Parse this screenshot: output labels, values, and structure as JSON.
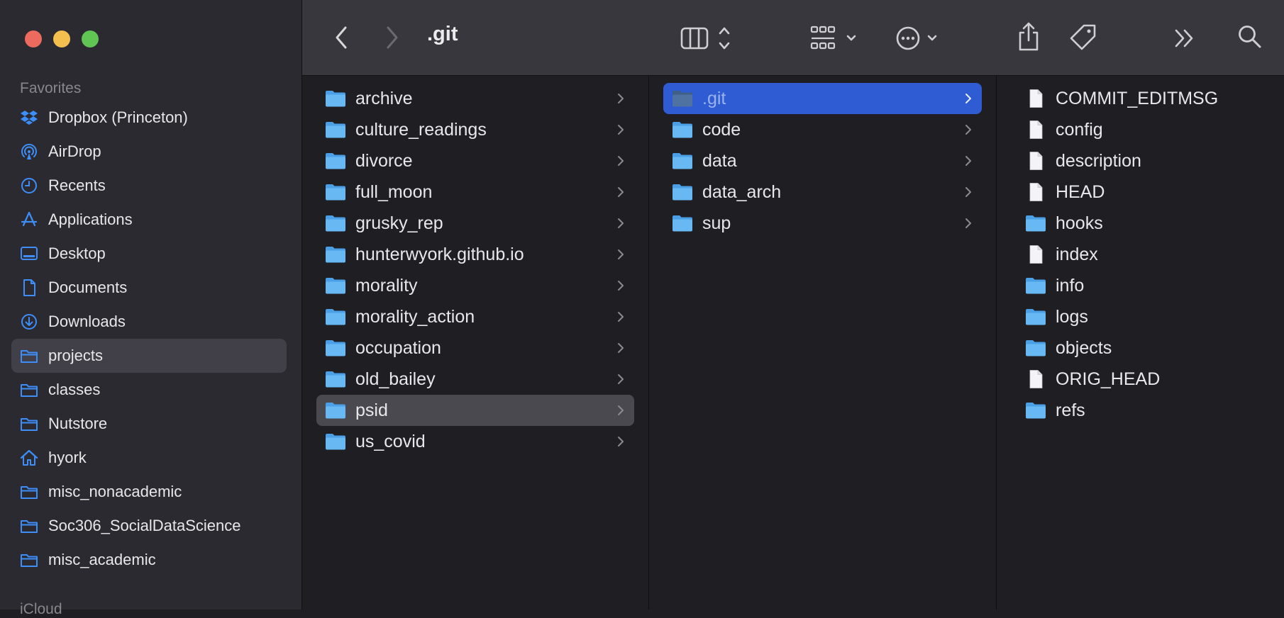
{
  "window": {
    "title": ".git"
  },
  "sidebar": {
    "section_title": "Favorites",
    "items": [
      {
        "label": "Dropbox (Princeton)",
        "icon": "dropbox-icon"
      },
      {
        "label": "AirDrop",
        "icon": "airdrop-icon"
      },
      {
        "label": "Recents",
        "icon": "clock-icon"
      },
      {
        "label": "Applications",
        "icon": "applications-icon"
      },
      {
        "label": "Desktop",
        "icon": "desktop-icon"
      },
      {
        "label": "Documents",
        "icon": "document-icon"
      },
      {
        "label": "Downloads",
        "icon": "download-icon"
      },
      {
        "label": "projects",
        "icon": "folder-icon",
        "selected": true
      },
      {
        "label": "classes",
        "icon": "folder-icon"
      },
      {
        "label": "Nutstore",
        "icon": "folder-icon"
      },
      {
        "label": "hyork",
        "icon": "home-icon"
      },
      {
        "label": "misc_nonacademic",
        "icon": "folder-icon"
      },
      {
        "label": "Soc306_SocialDataScience",
        "icon": "folder-icon"
      },
      {
        "label": "misc_academic",
        "icon": "folder-icon"
      }
    ],
    "next_section_partial": "iCloud"
  },
  "toolbar": {
    "back": "chevron-left-icon",
    "forward": "chevron-right-icon",
    "view": "column-view-icon",
    "group": "grid-group-icon",
    "action": "more-actions-icon",
    "share": "share-icon",
    "tags": "tag-icon",
    "overflow": "double-chevron-icon",
    "search": "search-icon"
  },
  "columns": [
    {
      "items": [
        {
          "name": "archive",
          "type": "folder"
        },
        {
          "name": "culture_readings",
          "type": "folder"
        },
        {
          "name": "divorce",
          "type": "folder"
        },
        {
          "name": "full_moon",
          "type": "folder"
        },
        {
          "name": "grusky_rep",
          "type": "folder"
        },
        {
          "name": "hunterwyork.github.io",
          "type": "folder"
        },
        {
          "name": "morality",
          "type": "folder"
        },
        {
          "name": "morality_action",
          "type": "folder"
        },
        {
          "name": "occupation",
          "type": "folder"
        },
        {
          "name": "old_bailey",
          "type": "folder"
        },
        {
          "name": "psid",
          "type": "folder",
          "selected": "inactive"
        },
        {
          "name": "us_covid",
          "type": "folder"
        }
      ]
    },
    {
      "items": [
        {
          "name": ".git",
          "type": "folder",
          "selected": "active",
          "hidden": true
        },
        {
          "name": "code",
          "type": "folder"
        },
        {
          "name": "data",
          "type": "folder"
        },
        {
          "name": "data_arch",
          "type": "folder"
        },
        {
          "name": "sup",
          "type": "folder"
        }
      ]
    },
    {
      "items": [
        {
          "name": "COMMIT_EDITMSG",
          "type": "file"
        },
        {
          "name": "config",
          "type": "file"
        },
        {
          "name": "description",
          "type": "file"
        },
        {
          "name": "HEAD",
          "type": "file"
        },
        {
          "name": "hooks",
          "type": "folder"
        },
        {
          "name": "index",
          "type": "file"
        },
        {
          "name": "info",
          "type": "folder"
        },
        {
          "name": "logs",
          "type": "folder"
        },
        {
          "name": "objects",
          "type": "folder"
        },
        {
          "name": "ORIG_HEAD",
          "type": "file"
        },
        {
          "name": "refs",
          "type": "folder"
        }
      ]
    }
  ],
  "colors": {
    "accent": "#2f5bd3",
    "sidebar_icon": "#3d8ef8",
    "folder": "#5ab1f0"
  }
}
